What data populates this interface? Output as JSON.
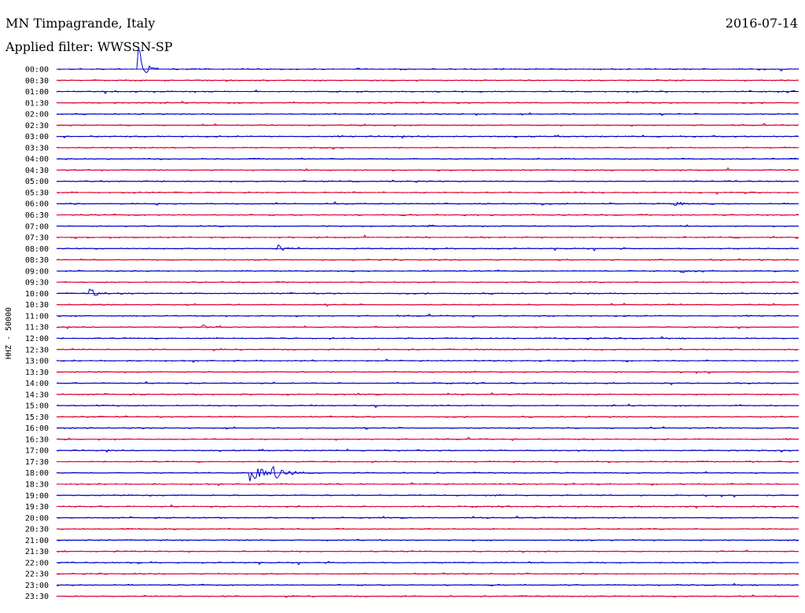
{
  "header": {
    "station": "MN Timpagrande, Italy",
    "date": "2016-07-14",
    "filter": "Applied filter: WWSSN-SP"
  },
  "chart_data": {
    "type": "line",
    "ylabel": "HHZ - 50000",
    "row_labels": [
      "00:00",
      "00:30",
      "01:00",
      "01:30",
      "02:00",
      "02:30",
      "03:00",
      "03:30",
      "04:00",
      "04:30",
      "05:00",
      "05:30",
      "06:00",
      "06:30",
      "07:00",
      "07:30",
      "08:00",
      "08:30",
      "09:00",
      "09:30",
      "10:00",
      "10:30",
      "11:00",
      "11:30",
      "12:00",
      "12:30",
      "13:00",
      "13:30",
      "14:00",
      "14:30",
      "15:00",
      "15:30",
      "16:00",
      "16:30",
      "17:00",
      "17:30",
      "18:00",
      "18:30",
      "19:00",
      "19:30",
      "20:00",
      "20:30",
      "21:00",
      "21:30",
      "22:00",
      "22:30",
      "23:00",
      "23:30"
    ],
    "series_colors": [
      "#0000cc",
      "#dd0033"
    ],
    "row_minutes": 30,
    "events": [
      {
        "row": "00:00",
        "minute": 3.3,
        "amplitude": 3.0,
        "duration_min": 0.8
      },
      {
        "row": "02:00",
        "minute": 17.0,
        "amplitude": 0.2,
        "duration_min": 0.2
      },
      {
        "row": "06:00",
        "minute": 25.0,
        "amplitude": 0.3,
        "duration_min": 1.3
      },
      {
        "row": "06:30",
        "minute": 16.5,
        "amplitude": 0.12,
        "duration_min": 0.6
      },
      {
        "row": "07:00",
        "minute": 15.0,
        "amplitude": 0.3,
        "duration_min": 0.4
      },
      {
        "row": "08:00",
        "minute": 8.9,
        "amplitude": 0.7,
        "duration_min": 0.8
      },
      {
        "row": "09:00",
        "minute": 21.0,
        "amplitude": 0.15,
        "duration_min": 0.4
      },
      {
        "row": "09:00",
        "minute": 25.2,
        "amplitude": 0.6,
        "duration_min": 0.5
      },
      {
        "row": "09:30",
        "minute": 5.5,
        "amplitude": 0.2,
        "duration_min": 0.2
      },
      {
        "row": "10:00",
        "minute": 1.3,
        "amplitude": 0.7,
        "duration_min": 1.0
      },
      {
        "row": "11:30",
        "minute": 5.9,
        "amplitude": 0.3,
        "duration_min": 0.5
      },
      {
        "row": "12:00",
        "minute": 21.5,
        "amplitude": 0.2,
        "duration_min": 0.4
      },
      {
        "row": "15:00",
        "minute": 2.3,
        "amplitude": 0.45,
        "duration_min": 0.3
      },
      {
        "row": "18:00",
        "minute": 7.8,
        "amplitude": 1.2,
        "duration_min": 1.6
      },
      {
        "row": "18:00",
        "minute": 8.7,
        "amplitude": 0.9,
        "duration_min": 1.6
      }
    ]
  }
}
